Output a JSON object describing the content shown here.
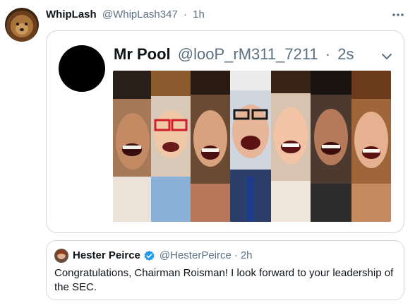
{
  "tweet": {
    "author_name": "WhipLash",
    "author_handle": "@WhipLash347",
    "separator": "·",
    "time": "1h",
    "more_icon": "more-horizontal-icon"
  },
  "quoted_tweet": {
    "author_name": "Mr Pool",
    "author_handle": "@looP_rM311_7211",
    "separator": "·",
    "time": "2s",
    "menu_icon": "chevron-down-icon"
  },
  "nested_quote": {
    "author_name": "Hester Peirce",
    "author_handle": "@HesterPeirce",
    "separator": "·",
    "time": "2h",
    "verified_icon": "verified-badge-icon",
    "text": "Congratulations, Chairman Roisman! I look forward to your leadership of the SEC."
  },
  "colors": {
    "text_primary": "#0f1419",
    "text_secondary": "#5b7083",
    "border": "#cfd9de",
    "verified_blue": "#1d9bf0"
  }
}
